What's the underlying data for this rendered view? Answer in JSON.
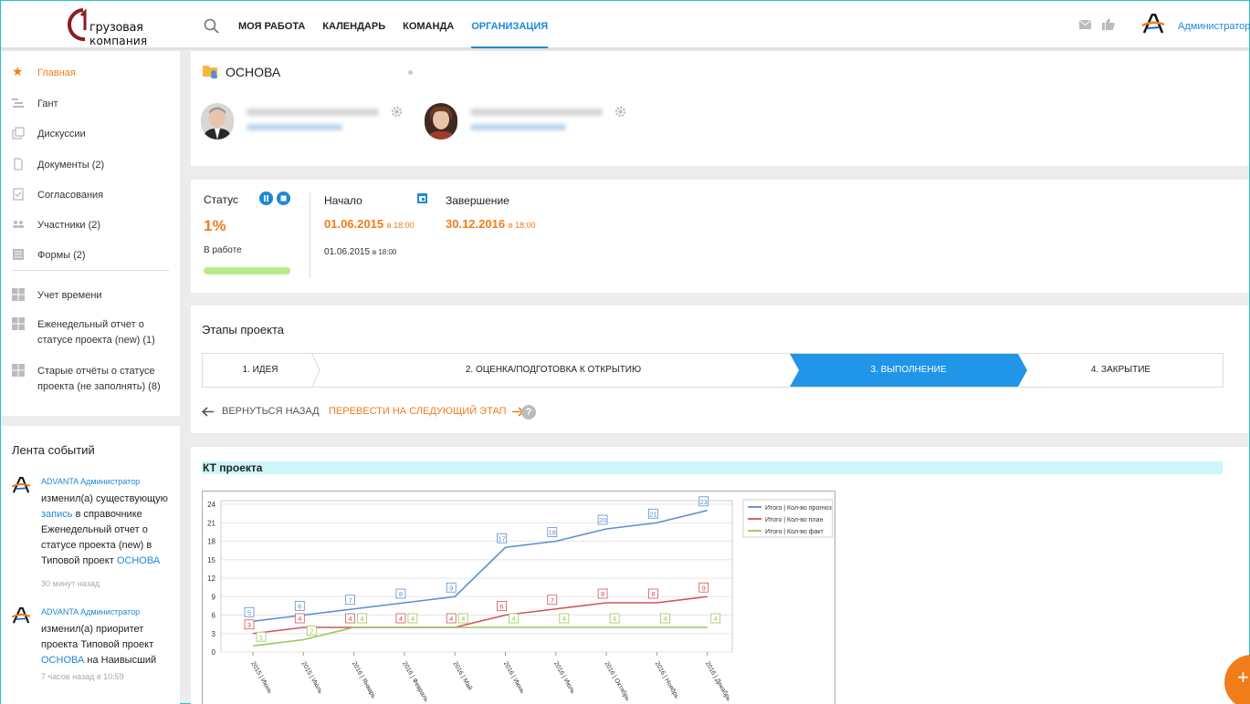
{
  "header": {
    "logo": {
      "line1": "грузовая",
      "line2": "компания"
    },
    "nav": [
      {
        "label": "МОЯ РАБОТА",
        "active": false
      },
      {
        "label": "КАЛЕНДАРЬ",
        "active": false
      },
      {
        "label": "КОМАНДА",
        "active": false
      },
      {
        "label": "ОРГАНИЗАЦИЯ",
        "active": true
      }
    ],
    "user": "Администратор"
  },
  "sidebar": {
    "items": [
      {
        "label": "Главная",
        "icon": "star-icon",
        "active": true
      },
      {
        "label": "Гант",
        "icon": "gantt-icon"
      },
      {
        "label": "Дискуссии",
        "icon": "discussion-icon"
      },
      {
        "label": "Документы (2)",
        "icon": "document-icon"
      },
      {
        "label": "Согласования",
        "icon": "approval-icon"
      },
      {
        "label": "Участники (2)",
        "icon": "people-icon"
      },
      {
        "label": "Формы (2)",
        "icon": "form-icon"
      }
    ],
    "reports": [
      {
        "label": "Учет времени",
        "icon": "table-icon"
      },
      {
        "label": "Еженедельный отчет о статусе проекта (new) (1)",
        "icon": "table-icon"
      },
      {
        "label": "Старые отчёты о статусе проекта (не заполнять) (8)",
        "icon": "table-icon"
      }
    ]
  },
  "feed": {
    "title": "Лента событий",
    "events": [
      {
        "who": "ADVANTA Администратор",
        "t1": "изменил(а) существующую",
        "link1": "запись",
        "t2": "в справочнике Еженедельный отчет о статусе проекта (new) в Типовой проект",
        "link2": "ОСНОВА",
        "time": "30 минут назад"
      },
      {
        "who": "ADVANTA Администратор",
        "t1": "изменил(а) приоритет проекта Типовой проект",
        "link2": "ОСНОВА",
        "t2": "на Наивысший",
        "time": "7 часов назад в 10:59"
      }
    ]
  },
  "project": {
    "title": "ОСНОВА"
  },
  "status": {
    "label": "Статус",
    "percent": "1%",
    "state": "В работе",
    "progress_fraction": 1.0,
    "start_label": "Начало",
    "start_date": "01.06.2015",
    "start_time": "в 18:00",
    "end_label": "Завершение",
    "end_date": "30.12.2016",
    "end_time": "в 18:00",
    "actual_start_date": "01.06.2015",
    "actual_start_time": "в 18:00"
  },
  "stages": {
    "title": "Этапы проекта",
    "items": [
      {
        "label": "1. ИДЕЯ"
      },
      {
        "label": "2. ОЦЕНКА/ПОДГОТОВКА К ОТКРЫТИЮ"
      },
      {
        "label": "3. ВЫПОЛНЕНИЕ",
        "active": true
      },
      {
        "label": "4. ЗАКРЫТИЕ"
      }
    ],
    "back": "ВЕРНУТЬСЯ НАЗАД",
    "next": "ПЕРЕВЕСТИ НА СЛЕДУЮЩИЙ ЭТАП",
    "help": "?"
  },
  "chart_section": {
    "title": "КТ проекта"
  },
  "fab": {
    "label": "+"
  },
  "chart_data": {
    "type": "line",
    "categories": [
      "2015 | Июнь",
      "2015 | Июль",
      "2016 | Январь",
      "2016 | Февраль",
      "2016 | Май",
      "2016 | Июнь",
      "2016 | Июль",
      "2016 | Октябрь",
      "2016 | Ноябрь",
      "2016 | Декабрь"
    ],
    "ylim": [
      0,
      24
    ],
    "yticks": [
      0,
      3,
      6,
      9,
      12,
      15,
      18,
      21,
      24
    ],
    "grid": true,
    "legend_position": "top-right",
    "series": [
      {
        "name": "Итого | Кол-во прогноз",
        "color": "#5b8fcf",
        "values": [
          5,
          6,
          7,
          8,
          9,
          17,
          18,
          20,
          21,
          23
        ]
      },
      {
        "name": "Итого | Кол-во план",
        "color": "#d0545a",
        "values": [
          3,
          4,
          4,
          4,
          4,
          6,
          7,
          8,
          8,
          9
        ]
      },
      {
        "name": "Итого | Кол-во факт",
        "color": "#9cc55a",
        "values": [
          1,
          2,
          4,
          4,
          4,
          4,
          4,
          4,
          4,
          4
        ]
      }
    ]
  }
}
